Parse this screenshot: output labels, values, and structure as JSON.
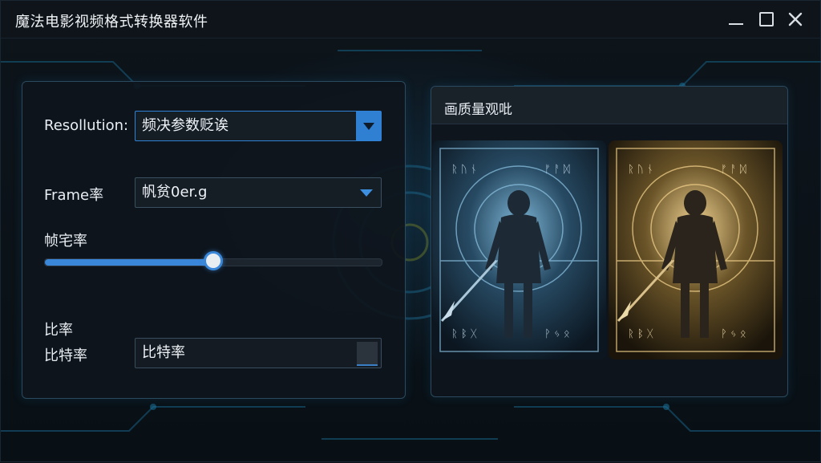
{
  "window": {
    "title": "魔法电影视频格式转换器软件",
    "controls": [
      "minimize-icon",
      "maximize-icon",
      "close-icon"
    ]
  },
  "settings": {
    "resolution_label": "Resollution:",
    "resolution_value": "频决参数贬诶",
    "framerate_label": "Frame率",
    "framerate_value": "帆贫0er.g",
    "slider_label": "帧宅率",
    "slider_value_fraction": 0.5,
    "ratio_label": "比率",
    "bitrate_label": "比特率",
    "bitrate_value": "比特率"
  },
  "preview": {
    "title": "画质量观吡",
    "images": [
      "preview-original",
      "preview-enhanced"
    ]
  },
  "colors": {
    "accent": "#2f7fd2",
    "background": "#0b1218",
    "panel_border": "#2a4a60"
  }
}
